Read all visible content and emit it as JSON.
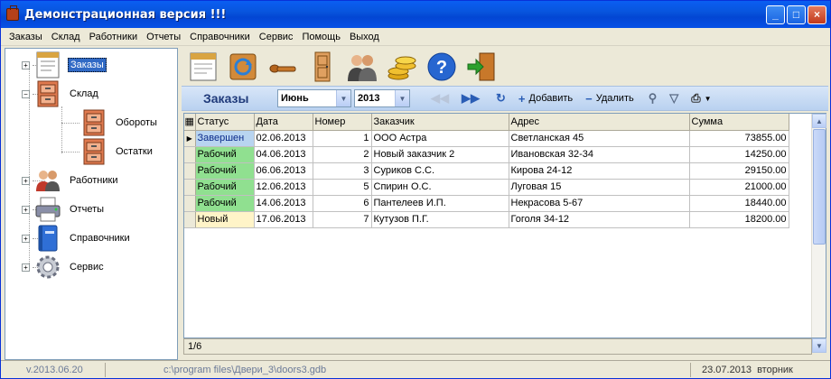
{
  "window": {
    "title": "Демонстрационная версия !!!",
    "min": "_",
    "max": "□",
    "close": "×"
  },
  "menu": [
    "Заказы",
    "Склад",
    "Работники",
    "Отчеты",
    "Справочники",
    "Сервис",
    "Помощь",
    "Выход"
  ],
  "tree": {
    "orders": "Заказы",
    "warehouse": "Склад",
    "turnover": "Обороты",
    "stock": "Остатки",
    "workers": "Работники",
    "reports": "Отчеты",
    "directories": "Справочники",
    "service": "Сервис",
    "expand_plus": "+",
    "expand_minus": "−"
  },
  "nav": {
    "title": "Заказы",
    "month": "Июнь",
    "year": "2013",
    "add": "Добавить",
    "delete": "Удалить"
  },
  "grid": {
    "columns": [
      "Статус",
      "Дата",
      "Номер",
      "Заказчик",
      "Адрес",
      "Сумма"
    ],
    "rows": [
      {
        "status": "Завершен",
        "date": "02.06.2013",
        "number": "1",
        "customer": "ООО Астра",
        "address": "Светланская 45",
        "sum": "73855.00",
        "status_color": "#b8d4f0"
      },
      {
        "status": "Рабочий",
        "date": "04.06.2013",
        "number": "2",
        "customer": "Новый заказчик 2",
        "address": "Ивановская 32-34",
        "sum": "14250.00",
        "status_color": "#90e090"
      },
      {
        "status": "Рабочий",
        "date": "06.06.2013",
        "number": "3",
        "customer": "Суриков С.С.",
        "address": "Кирова 24-12",
        "sum": "29150.00",
        "status_color": "#90e090"
      },
      {
        "status": "Рабочий",
        "date": "12.06.2013",
        "number": "5",
        "customer": "Спирин О.С.",
        "address": "Луговая 15",
        "sum": "21000.00",
        "status_color": "#90e090"
      },
      {
        "status": "Рабочий",
        "date": "14.06.2013",
        "number": "6",
        "customer": "Пантелеев И.П.",
        "address": "Некрасова 5-67",
        "sum": "18440.00",
        "status_color": "#90e090"
      },
      {
        "status": "Новый",
        "date": "17.06.2013",
        "number": "7",
        "customer": "Кутузов П.Г.",
        "address": "Гоголя 34-12",
        "sum": "18200.00",
        "status_color": "#fff4c8"
      }
    ],
    "footer": "1/6"
  },
  "status": {
    "version": "v.2013.06.20",
    "path": "c:\\program files\\Двери_3\\doors3.gdb",
    "date": "23.07.2013",
    "weekday": "вторник"
  }
}
